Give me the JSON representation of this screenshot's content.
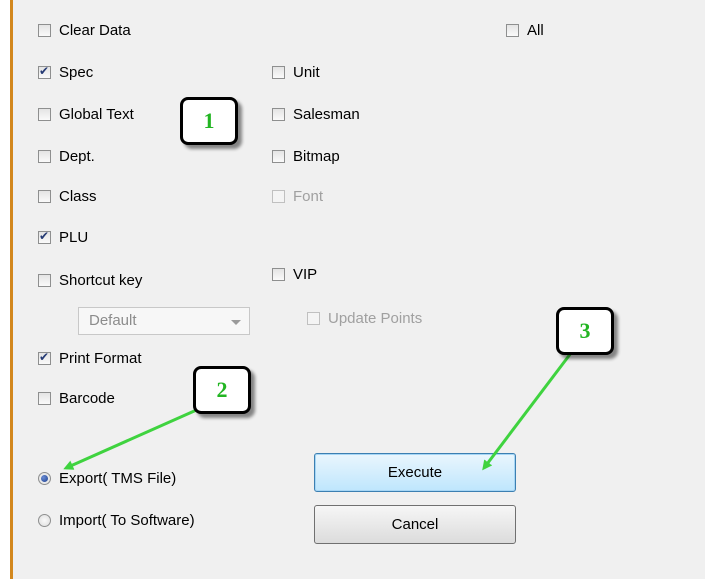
{
  "options": {
    "clear_data": {
      "label": "Clear Data",
      "checked": false
    },
    "all": {
      "label": "All",
      "checked": false
    },
    "spec": {
      "label": "Spec",
      "checked": true
    },
    "unit": {
      "label": "Unit",
      "checked": false
    },
    "global_text": {
      "label": "Global Text",
      "checked": false
    },
    "salesman": {
      "label": "Salesman",
      "checked": false
    },
    "dept": {
      "label": "Dept.",
      "checked": false
    },
    "bitmap": {
      "label": "Bitmap",
      "checked": false
    },
    "class": {
      "label": "Class",
      "checked": false
    },
    "font": {
      "label": "Font",
      "checked": false,
      "disabled": true
    },
    "plu": {
      "label": "PLU",
      "checked": true
    },
    "shortcut_key": {
      "label": "Shortcut key",
      "checked": false
    },
    "vip": {
      "label": "VIP",
      "checked": false
    },
    "update_points": {
      "label": "Update Points",
      "checked": false,
      "disabled": true
    },
    "print_format": {
      "label": "Print Format",
      "checked": true
    },
    "barcode": {
      "label": "Barcode",
      "checked": false
    }
  },
  "shortcut_select": {
    "value": "Default",
    "disabled": true
  },
  "mode": {
    "export_label": "Export( TMS File)",
    "import_label": "Import( To Software)",
    "selected": "export"
  },
  "buttons": {
    "execute": "Execute",
    "cancel": "Cancel"
  },
  "callouts": {
    "one": "1",
    "two": "2",
    "three": "3"
  },
  "colors": {
    "callout_text": "#22b522",
    "arrow": "#3fd33f",
    "panel_border": "#d3881e"
  }
}
